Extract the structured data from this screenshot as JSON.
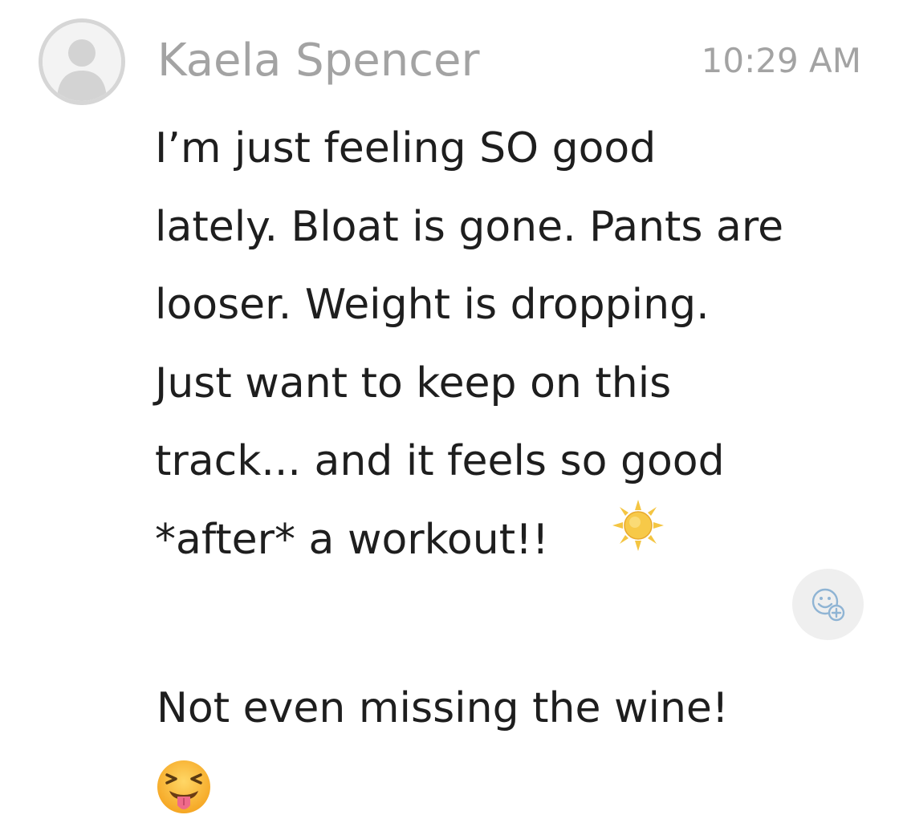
{
  "message": {
    "sender_name": "Kaela Spencer",
    "timestamp": "10:29 AM",
    "body": "I’m just feeling SO good\nlately. Bloat is gone. Pants are\nlooser. Weight is dropping.\nJust want to keep on this\ntrack... and it feels so good\n*after* a workout!!",
    "emoji_1": "sun-emoji",
    "second_line": "Not even missing the wine!",
    "emoji_2": "squinting-face-with-tongue-emoji"
  },
  "icons": {
    "avatar": "default-person-avatar",
    "reaction": "add-reaction-icon"
  },
  "colors": {
    "name_and_time": "#a3a3a3",
    "message_text": "#1e1e1e",
    "reaction_bg": "#efefef",
    "reaction_icon": "#8fb4d4"
  }
}
